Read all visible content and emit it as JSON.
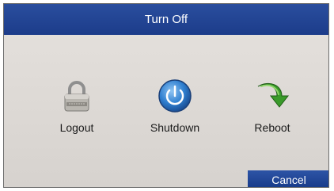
{
  "dialog": {
    "title": "Turn Off"
  },
  "options": [
    {
      "label": "Logout",
      "icon": "padlock-icon"
    },
    {
      "label": "Shutdown",
      "icon": "power-icon"
    },
    {
      "label": "Reboot",
      "icon": "green-arrow-icon"
    }
  ],
  "buttons": {
    "cancel_label": "Cancel"
  },
  "colors": {
    "titlebar": "#1c3c8a",
    "panel": "#dcd8d4",
    "button": "#1e44a0",
    "reboot_arrow": "#3a9a2a"
  }
}
